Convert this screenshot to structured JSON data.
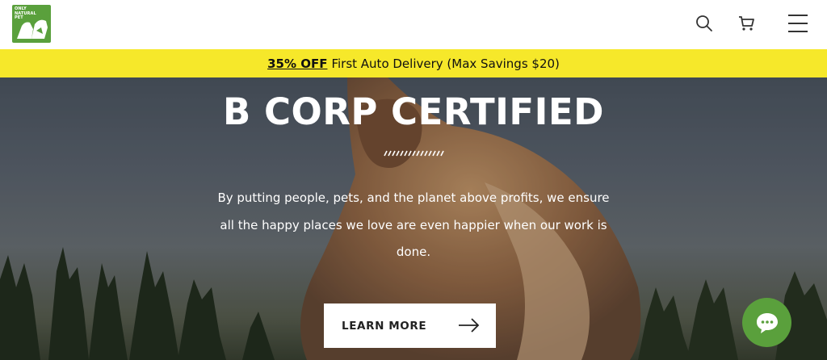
{
  "header": {
    "logo_text": [
      "ONLY",
      "NATURAL",
      "PET"
    ],
    "brand_color": "#5aa03c",
    "icons": [
      "search-icon",
      "cart-icon",
      "menu-icon"
    ]
  },
  "promo": {
    "strong": "35% OFF",
    "text": "First Auto Delivery (Max Savings $20)",
    "background": "#f6e82a"
  },
  "hero": {
    "title": "B CORP CERTIFIED",
    "body": "By putting people, pets, and the planet above profits, we ensure all the happy places we love are even happier when our work is done.",
    "cta_label": "LEARN MORE"
  },
  "chat": {
    "icon": "chat-bubble-icon",
    "color": "#5aa03c"
  }
}
